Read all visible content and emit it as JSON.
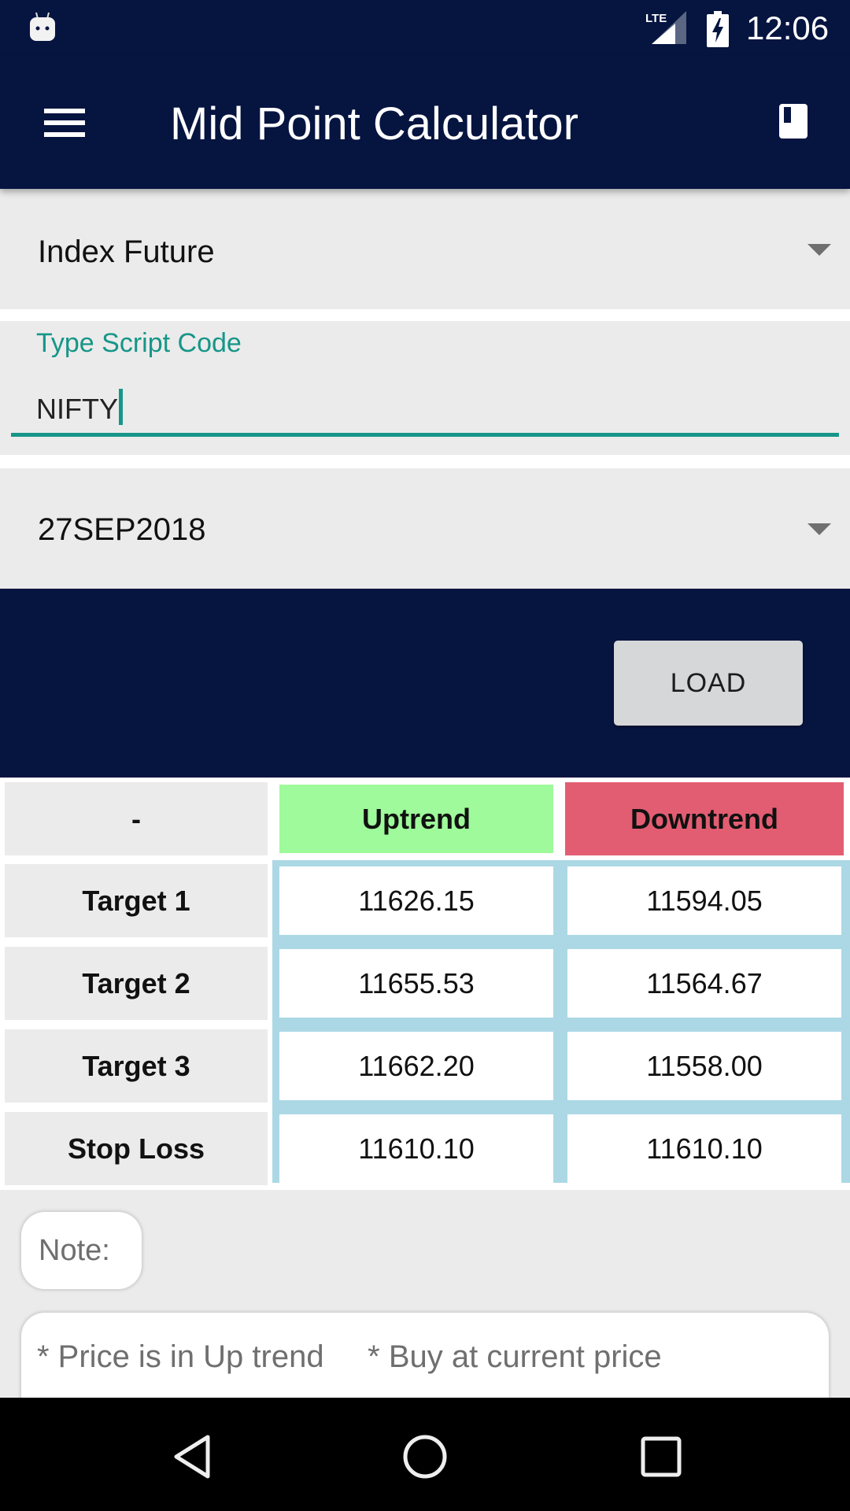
{
  "status_bar": {
    "time": "12:06",
    "network": "LTE",
    "icons": [
      "android-notification-icon",
      "lte-signal-icon",
      "battery-charging-icon"
    ]
  },
  "app_bar": {
    "title": "Mid Point Calculator",
    "menu_icon": "hamburger-menu-icon",
    "action_icon": "book-icon"
  },
  "form": {
    "instrument_type": {
      "selected": "Index Future"
    },
    "script_code": {
      "label": "Type Script Code",
      "value": "NIFTY"
    },
    "expiry": {
      "selected": "27SEP2018"
    },
    "load_button": "LOAD"
  },
  "colors": {
    "primary": "#061440",
    "accent": "#169688",
    "uptrend": "#9efa9a",
    "downtrend": "#e35d72",
    "value_border": "#acd8e5"
  },
  "table": {
    "headers": [
      "-",
      "Uptrend",
      "Downtrend"
    ],
    "rows": [
      {
        "label": "Target 1",
        "uptrend": "11626.15",
        "downtrend": "11594.05"
      },
      {
        "label": "Target 2",
        "uptrend": "11655.53",
        "downtrend": "11564.67"
      },
      {
        "label": "Target 3",
        "uptrend": "11662.20",
        "downtrend": "11558.00"
      },
      {
        "label": "Stop Loss",
        "uptrend": "11610.10",
        "downtrend": "11610.10"
      }
    ]
  },
  "note": {
    "label": "Note:",
    "text": "* Price is in Up trend     * Buy at current price"
  },
  "nav_bar": {
    "buttons": [
      "back",
      "home",
      "recents"
    ]
  }
}
